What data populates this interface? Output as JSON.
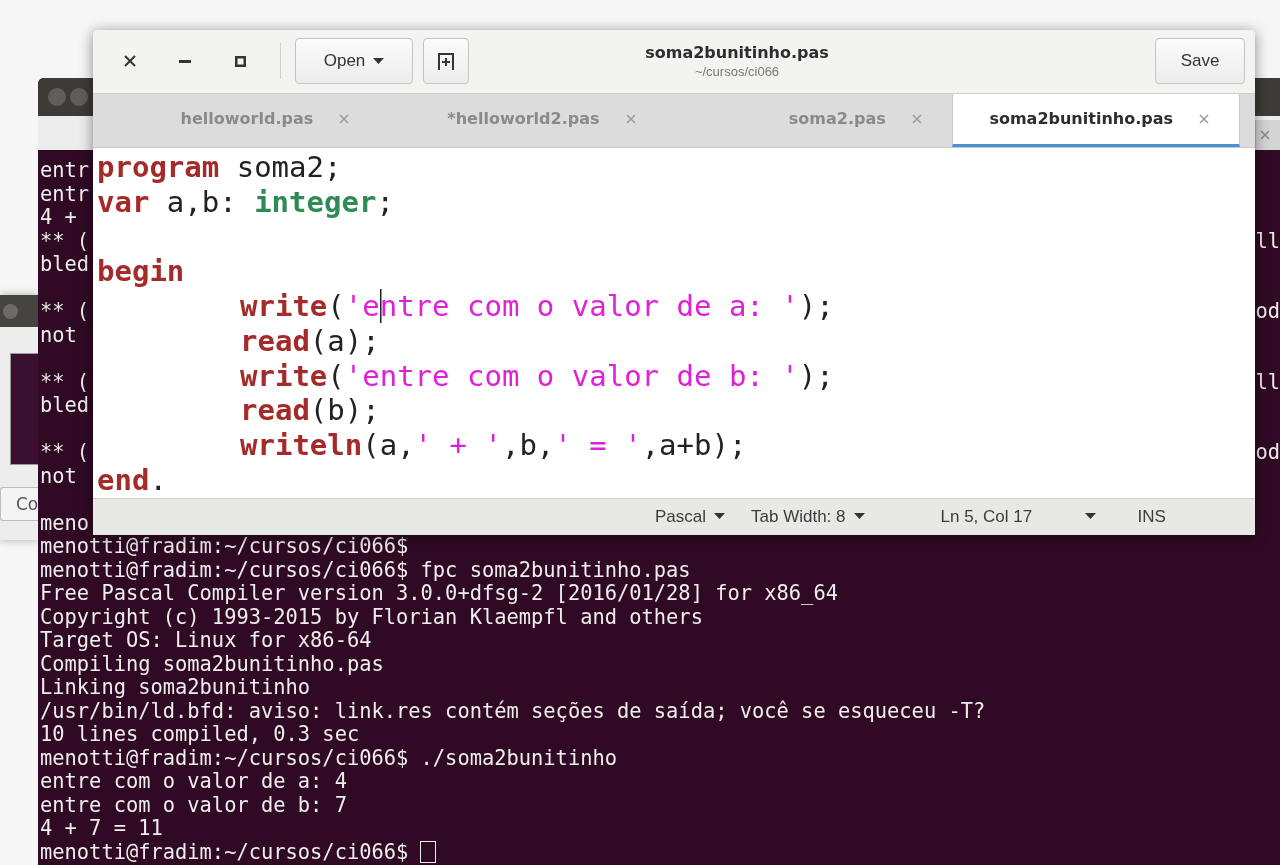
{
  "side_window": {
    "button_label": "Co"
  },
  "terminal": {
    "covered_lines": [
      {
        "left": "entr",
        "blank_after": false
      },
      {
        "left": "entr",
        "blank_after": false
      },
      {
        "left": "4 +",
        "blank_after": false
      },
      {
        "left": "** (",
        "right": "ll",
        "blank_after": false
      },
      {
        "left": "bled",
        "blank_after": true
      },
      {
        "left": "** (",
        "right": "od",
        "blank_after": false
      },
      {
        "left": "not",
        "blank_after": true
      },
      {
        "left": "** (",
        "right": "ll",
        "blank_after": false
      },
      {
        "left": "bled",
        "blank_after": true
      },
      {
        "left": "** (",
        "right": "od",
        "blank_after": false
      },
      {
        "left": "not",
        "blank_after": true
      },
      {
        "left": "meno",
        "blank_after": false
      }
    ],
    "lines": [
      "menotti@fradim:~/cursos/ci066$",
      "menotti@fradim:~/cursos/ci066$ fpc soma2bunitinho.pas",
      "Free Pascal Compiler version 3.0.0+dfsg-2 [2016/01/28] for x86_64",
      "Copyright (c) 1993-2015 by Florian Klaempfl and others",
      "Target OS: Linux for x86-64",
      "Compiling soma2bunitinho.pas",
      "Linking soma2bunitinho",
      "/usr/bin/ld.bfd: aviso: link.res contém seções de saída; você se esqueceu -T?",
      "10 lines compiled, 0.3 sec",
      "menotti@fradim:~/cursos/ci066$ ./soma2bunitinho",
      "entre com o valor de a: 4",
      "entre com o valor de b: 7",
      "4 + 7 = 11",
      "menotti@fradim:~/cursos/ci066$"
    ],
    "cursor_visible": true
  },
  "editor": {
    "open_button": "Open",
    "title": "soma2bunitinho.pas",
    "subtitle": "~/cursos/ci066",
    "save_button": "Save",
    "tabs": [
      {
        "label": "helloworld.pas",
        "selected": false
      },
      {
        "label": "*helloworld2.pas",
        "selected": false
      },
      {
        "label": "soma2.pas",
        "selected": false
      },
      {
        "label": "soma2bunitinho.pas",
        "selected": true
      }
    ],
    "code_lines": [
      {
        "indented": false,
        "tokens": [
          {
            "kind": "keyword",
            "text": "program"
          },
          {
            "kind": "plain",
            "text": " soma2;"
          }
        ]
      },
      {
        "indented": false,
        "blank_after": true,
        "tokens": [
          {
            "kind": "keyword",
            "text": "var"
          },
          {
            "kind": "plain",
            "text": " a,b: "
          },
          {
            "kind": "type",
            "text": "integer"
          },
          {
            "kind": "plain",
            "text": ";"
          }
        ]
      },
      {
        "indented": false,
        "tokens": [
          {
            "kind": "keyword",
            "text": "begin"
          }
        ]
      },
      {
        "indented": true,
        "tokens": [
          {
            "kind": "keyword",
            "text": "write"
          },
          {
            "kind": "plain",
            "text": "("
          },
          {
            "kind": "string",
            "text": "'e"
          },
          {
            "kind": "caret"
          },
          {
            "kind": "string",
            "text": "ntre com o valor de a: '"
          },
          {
            "kind": "plain",
            "text": ");"
          }
        ]
      },
      {
        "indented": true,
        "tokens": [
          {
            "kind": "keyword",
            "text": "read"
          },
          {
            "kind": "plain",
            "text": "(a);"
          }
        ]
      },
      {
        "indented": true,
        "tokens": [
          {
            "kind": "keyword",
            "text": "write"
          },
          {
            "kind": "plain",
            "text": "("
          },
          {
            "kind": "string",
            "text": "'entre com o valor de b: '"
          },
          {
            "kind": "plain",
            "text": ");"
          }
        ]
      },
      {
        "indented": true,
        "tokens": [
          {
            "kind": "keyword",
            "text": "read"
          },
          {
            "kind": "plain",
            "text": "(b);"
          }
        ]
      },
      {
        "indented": true,
        "tokens": [
          {
            "kind": "keyword",
            "text": "writeln"
          },
          {
            "kind": "plain",
            "text": "(a,"
          },
          {
            "kind": "string",
            "text": "' + '"
          },
          {
            "kind": "plain",
            "text": ",b,"
          },
          {
            "kind": "string",
            "text": "' = '"
          },
          {
            "kind": "plain",
            "text": ",a+b);"
          }
        ]
      },
      {
        "indented": false,
        "tokens": [
          {
            "kind": "keyword",
            "text": "end"
          },
          {
            "kind": "plain",
            "text": "."
          }
        ]
      }
    ],
    "status_bar": {
      "language": "Pascal",
      "tab_width": "Tab Width: 8",
      "position": "Ln 5, Col 17",
      "mode": "INS"
    }
  }
}
